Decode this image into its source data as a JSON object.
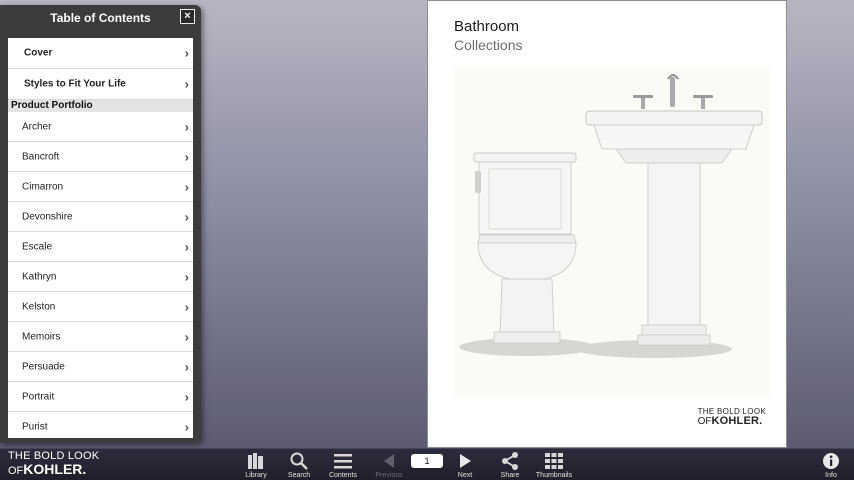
{
  "toc": {
    "title": "Table of Contents",
    "close_label": "×",
    "top_items": [
      {
        "label": "Cover"
      },
      {
        "label": "Styles to Fit Your Life"
      }
    ],
    "section_header": "Product Portfolio",
    "items": [
      {
        "label": "Archer"
      },
      {
        "label": "Bancroft"
      },
      {
        "label": "Cimarron"
      },
      {
        "label": "Devonshire"
      },
      {
        "label": "Escale"
      },
      {
        "label": "Kathryn"
      },
      {
        "label": "Kelston"
      },
      {
        "label": "Memoirs"
      },
      {
        "label": "Persuade"
      },
      {
        "label": "Portrait"
      },
      {
        "label": "Purist"
      }
    ]
  },
  "page": {
    "title": "Bathroom",
    "subtitle": "Collections",
    "logo_line1": "THE BOLD LOOK",
    "logo_of": "OF",
    "logo_brand": "KOHLER."
  },
  "toolbar": {
    "brand_line1": "THE BOLD LOOK",
    "brand_of": "OF",
    "brand_name": "KOHLER.",
    "library_label": "Library",
    "search_label": "Search",
    "contents_label": "Contents",
    "previous_label": "Previous",
    "page_number": "1",
    "next_label": "Next",
    "share_label": "Share",
    "thumbnails_label": "Thumbnails",
    "info_label": "Info"
  }
}
